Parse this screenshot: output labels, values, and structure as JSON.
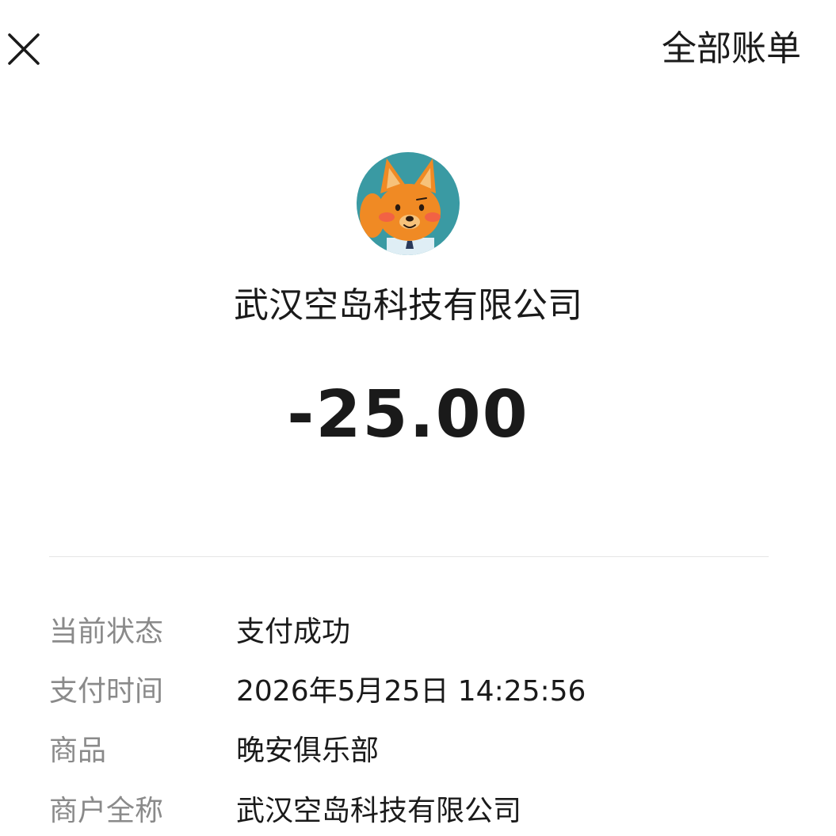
{
  "header": {
    "close_icon": "close-icon",
    "all_bills_label": "全部账单"
  },
  "merchant": {
    "avatar_icon": "fox-cartoon-avatar",
    "name": "武汉空岛科技有限公司"
  },
  "payment": {
    "amount": "-25.00"
  },
  "details": [
    {
      "label": "当前状态",
      "value": "支付成功"
    },
    {
      "label": "支付时间",
      "value": "2026年5月25日 14:25:56"
    },
    {
      "label": "商品",
      "value": "晚安俱乐部"
    },
    {
      "label": "商户全称",
      "value": "武汉空岛科技有限公司"
    }
  ],
  "colors": {
    "text_primary": "#1a1a1a",
    "text_secondary": "#8a8a8a",
    "divider": "#e6e6e6",
    "avatar_bg": "#3a9aa3",
    "avatar_fox": "#f08a24"
  }
}
